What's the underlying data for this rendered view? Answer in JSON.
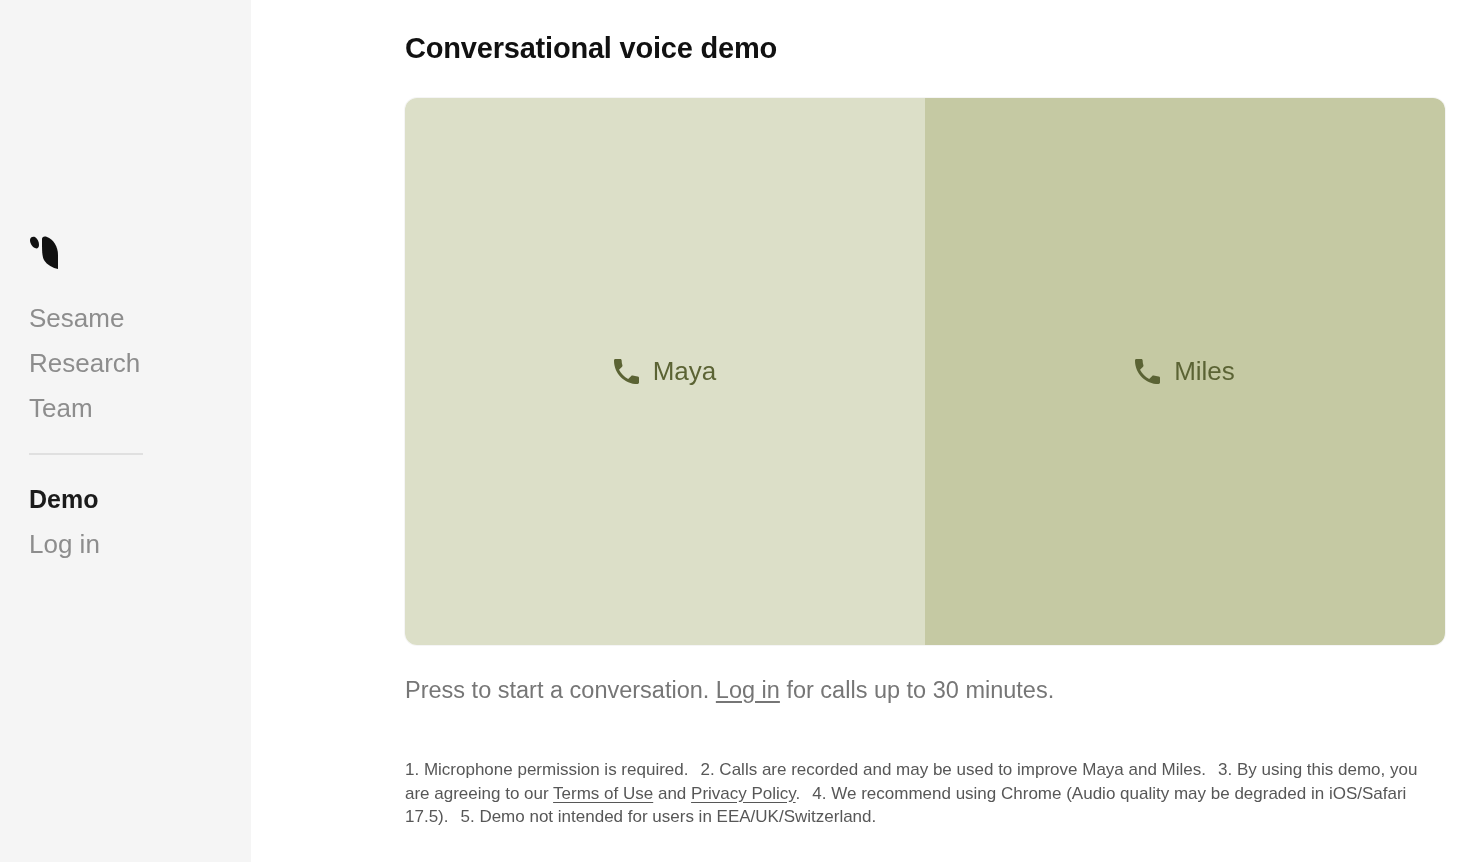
{
  "sidebar": {
    "nav": [
      {
        "label": "Sesame",
        "selected": false
      },
      {
        "label": "Research",
        "selected": false
      },
      {
        "label": "Team",
        "selected": false
      }
    ],
    "secondary_nav": [
      {
        "label": "Demo",
        "selected": true
      },
      {
        "label": "Log in",
        "selected": false
      }
    ]
  },
  "main": {
    "title": "Conversational voice demo",
    "voices": [
      {
        "name": "Maya",
        "color": "#dcdfc8"
      },
      {
        "name": "Miles",
        "color": "#c5c9a3"
      }
    ],
    "prompt": {
      "before": "Press to start a conversation.",
      "link": "Log in",
      "after": "for calls up to 30 minutes."
    },
    "notes": [
      [
        {
          "kind": "text",
          "text": "1. Microphone permission is required."
        }
      ],
      [
        {
          "kind": "text",
          "text": "2. Calls are recorded and may be used to improve Maya and Miles."
        }
      ],
      [
        {
          "kind": "text",
          "text": "3. By using this demo, you are agreeing to our"
        },
        {
          "kind": "link",
          "text": "Terms of Use"
        },
        {
          "kind": "text",
          "text": "and"
        },
        {
          "kind": "link",
          "text": "Privacy Policy"
        },
        {
          "kind": "text",
          "text": "."
        }
      ],
      [
        {
          "kind": "text",
          "text": "4. We recommend using Chrome (Audio quality may be degraded in iOS/Safari 17.5)."
        }
      ],
      [
        {
          "kind": "text",
          "text": "5. Demo not intended for users in EEA/UK/Switzerland."
        }
      ]
    ]
  }
}
